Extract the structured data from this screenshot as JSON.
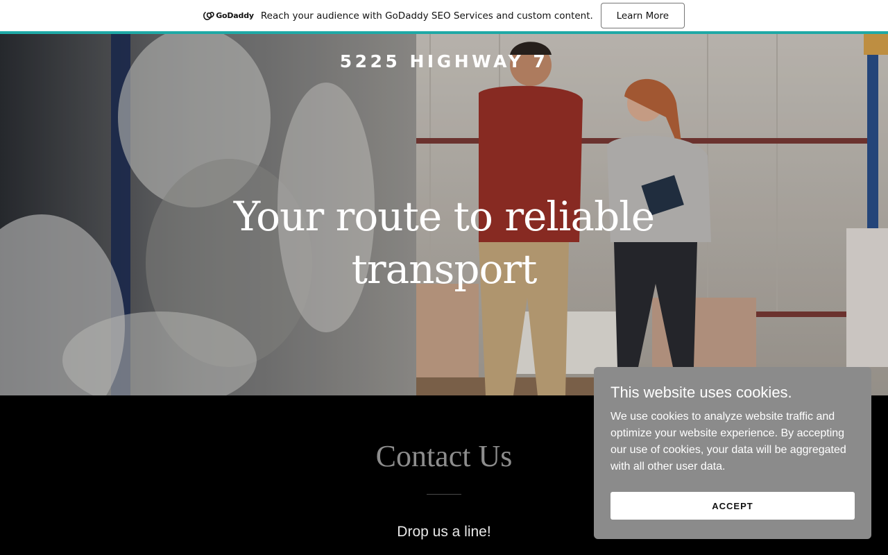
{
  "promo": {
    "logo_text": "GoDaddy",
    "message": "Reach your audience with GoDaddy SEO Services and custom content.",
    "cta_label": "Learn More",
    "strip_color": "#1fa9a6"
  },
  "hero": {
    "site_title": "5225 HIGHWAY 7",
    "heading": "Your route to reliable transport"
  },
  "contact": {
    "title": "Contact Us",
    "subtitle": "Drop us a line!"
  },
  "cookie_notice": {
    "title": "This website uses cookies.",
    "body": "We use cookies to analyze website traffic and optimize your website experience. By accepting our use of cookies, your data will be aggregated with all other user data.",
    "accept_label": "ACCEPT"
  }
}
